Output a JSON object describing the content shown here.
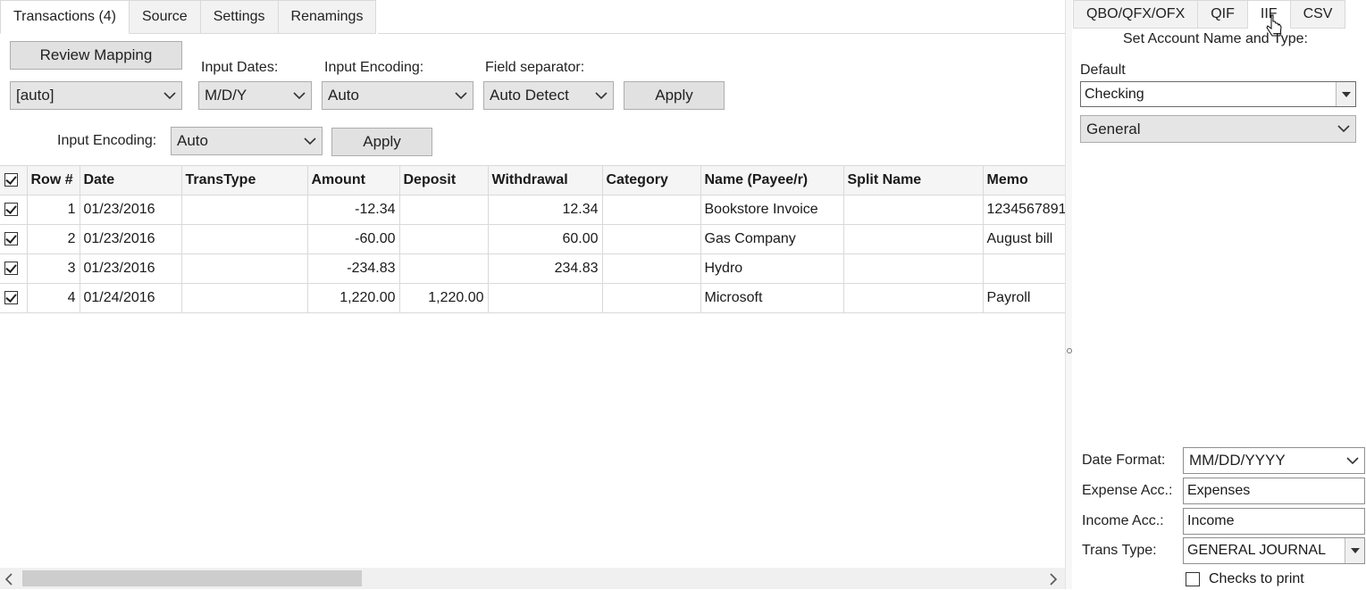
{
  "left_tabs": [
    "Transactions (4)",
    "Source",
    "Settings",
    "Renamings"
  ],
  "right_tabs": [
    "QBO/QFX/OFX",
    "QIF",
    "IIF",
    "CSV"
  ],
  "toolbar": {
    "review_mapping": "Review Mapping",
    "mapping_value": "[auto]",
    "input_dates_label": "Input Dates:",
    "input_dates_value": "M/D/Y",
    "input_encoding_label": "Input Encoding:",
    "input_encoding_value": "Auto",
    "field_separator_label": "Field separator:",
    "field_separator_value": "Auto Detect",
    "apply": "Apply",
    "input_encoding2_label": "Input Encoding:",
    "input_encoding2_value": "Auto",
    "apply2": "Apply"
  },
  "table": {
    "headers": [
      "Row #",
      "Date",
      "TransType",
      "Amount",
      "Deposit",
      "Withdrawal",
      "Category",
      "Name (Payee/r)",
      "Split Name",
      "Memo"
    ],
    "rows": [
      {
        "row": "1",
        "date": "01/23/2016",
        "transtype": "",
        "amount": "-12.34",
        "deposit": "",
        "withdrawal": "12.34",
        "category": "",
        "name": "Bookstore Invoice",
        "split": "",
        "memo": "1234567891"
      },
      {
        "row": "2",
        "date": "01/23/2016",
        "transtype": "",
        "amount": "-60.00",
        "deposit": "",
        "withdrawal": "60.00",
        "category": "",
        "name": "Gas Company",
        "split": "",
        "memo": "August bill"
      },
      {
        "row": "3",
        "date": "01/23/2016",
        "transtype": "",
        "amount": "-234.83",
        "deposit": "",
        "withdrawal": "234.83",
        "category": "",
        "name": "Hydro",
        "split": "",
        "memo": ""
      },
      {
        "row": "4",
        "date": "01/24/2016",
        "transtype": "",
        "amount": "1,220.00",
        "deposit": "1,220.00",
        "withdrawal": "",
        "category": "",
        "name": "Microsoft",
        "split": "",
        "memo": "Payroll"
      }
    ]
  },
  "right_panel": {
    "heading": "Set Account Name and Type:",
    "default_label": "Default",
    "account_name": "Checking",
    "account_type": "General",
    "date_format_label": "Date Format:",
    "date_format_value": "MM/DD/YYYY",
    "expense_label": "Expense Acc.:",
    "expense_value": "Expenses",
    "income_label": "Income Acc.:",
    "income_value": "Income",
    "trans_type_label": "Trans Type:",
    "trans_type_value": "GENERAL JOURNAL",
    "checks_label": "Checks to print"
  }
}
